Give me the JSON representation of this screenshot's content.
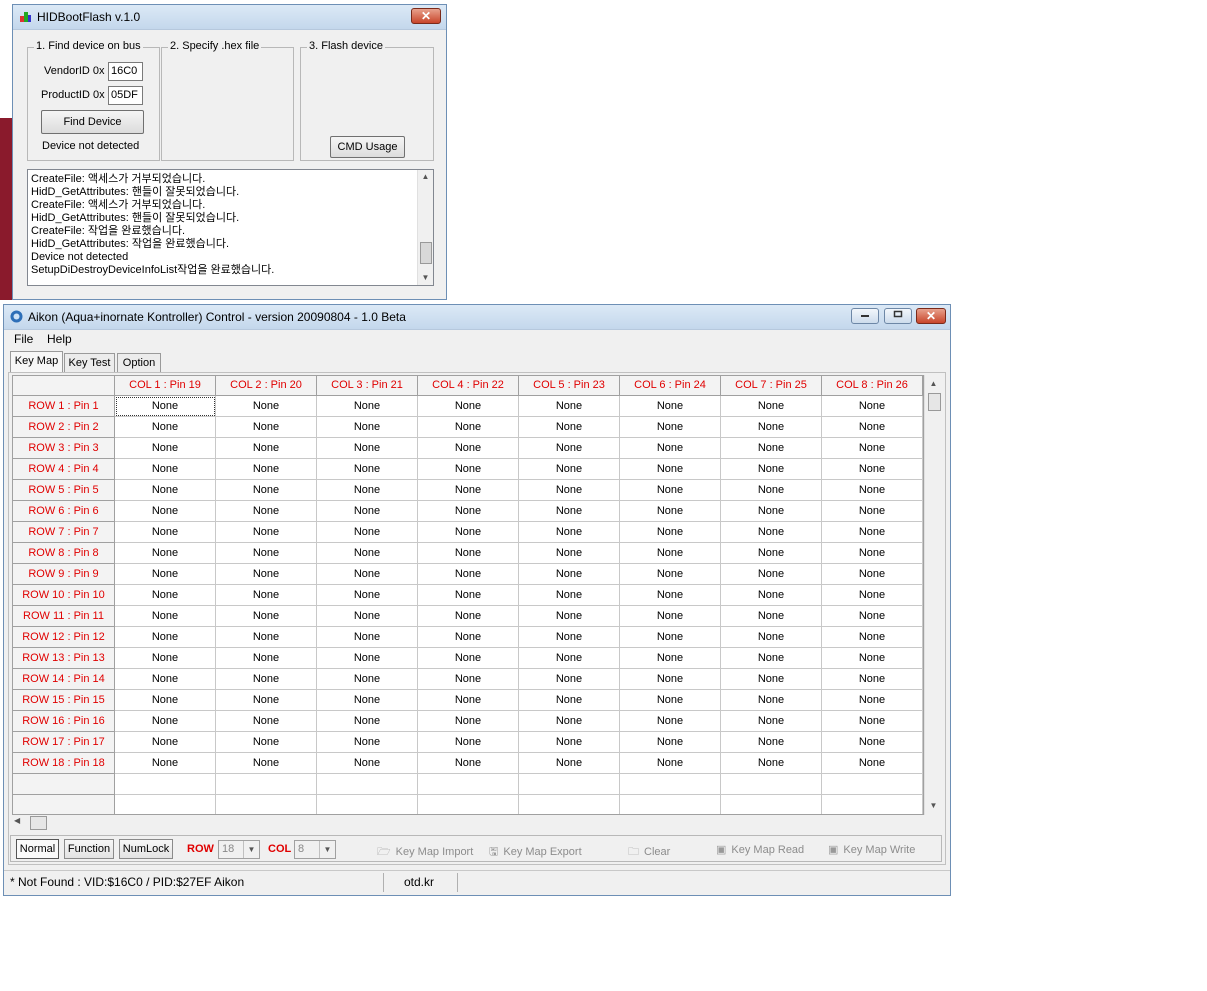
{
  "hidflash": {
    "title": "HIDBootFlash v.1.0",
    "close_glyph": "✕",
    "group1_title": "1. Find device on bus",
    "group2_title": "2. Specify .hex file",
    "group3_title": "3. Flash device",
    "vendor_label": "VendorID 0x",
    "vendor_value": "16C0",
    "product_label": "ProductID 0x",
    "product_value": "05DF",
    "find_button": "Find Device",
    "device_status": "Device not detected",
    "cmd_button": "CMD Usage",
    "log": [
      "CreateFile: 액세스가 거부되었습니다.",
      "HidD_GetAttributes: 핸들이 잘못되었습니다.",
      "CreateFile: 액세스가 거부되었습니다.",
      "HidD_GetAttributes: 핸들이 잘못되었습니다.",
      "CreateFile: 작업을 완료했습니다.",
      "HidD_GetAttributes: 작업을 완료했습니다.",
      "Device not detected",
      "SetupDiDestroyDeviceInfoList작업을 완료했습니다."
    ]
  },
  "aikon": {
    "title": "Aikon (Aqua+inornate Kontroller) Control - version 20090804 - 1.0 Beta",
    "menu": [
      "File",
      "Help"
    ],
    "tabs": [
      "Key Map",
      "Key Test",
      "Option"
    ],
    "columns": [
      "COL 1 : Pin 19",
      "COL 2 : Pin 20",
      "COL 3 : Pin 21",
      "COL 4 : Pin 22",
      "COL 5 : Pin 23",
      "COL 6 : Pin 24",
      "COL 7 : Pin 25",
      "COL 8 : Pin 26"
    ],
    "rows": [
      "ROW 1 : Pin 1",
      "ROW 2 : Pin 2",
      "ROW 3 : Pin 3",
      "ROW 4 : Pin 4",
      "ROW 5 : Pin 5",
      "ROW 6 : Pin 6",
      "ROW 7 : Pin 7",
      "ROW 8 : Pin 8",
      "ROW 9 : Pin 9",
      "ROW 10 : Pin 10",
      "ROW 11 : Pin 11",
      "ROW 12 : Pin 12",
      "ROW 13 : Pin 13",
      "ROW 14 : Pin 14",
      "ROW 15 : Pin 15",
      "ROW 16 : Pin 16",
      "ROW 17 : Pin 17",
      "ROW 18 : Pin 18"
    ],
    "cell_value": "None",
    "bottom": {
      "normal": "Normal",
      "function": "Function",
      "numlock": "NumLock",
      "row_label": "ROW",
      "row_value": "18",
      "col_label": "COL",
      "col_value": "8",
      "import": "Key Map Import",
      "export": "Key Map Export",
      "clear": "Clear",
      "read": "Key Map Read",
      "write": "Key Map Write"
    },
    "status": {
      "left": "* Not Found : VID:$16C0 / PID:$27EF Aikon",
      "mid": "otd.kr"
    }
  }
}
